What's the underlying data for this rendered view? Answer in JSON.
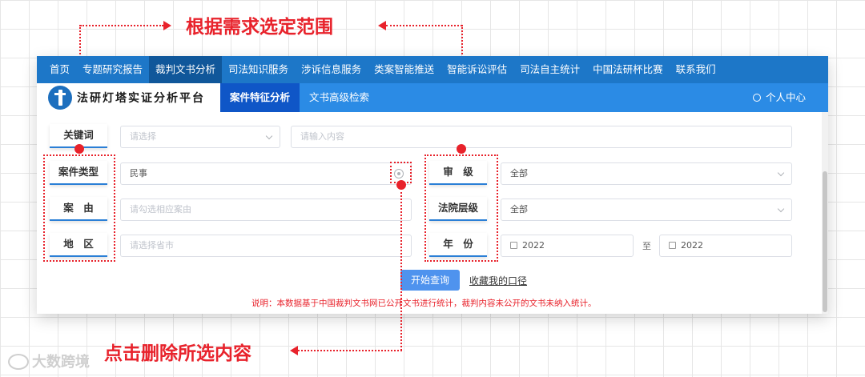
{
  "annotations": {
    "select_range": "根据需求选定范围",
    "click_delete": "点击删除所选内容"
  },
  "top_nav": [
    {
      "label": "首页",
      "active": false
    },
    {
      "label": "专题研究报告",
      "active": false
    },
    {
      "label": "裁判文书分析",
      "active": true
    },
    {
      "label": "司法知识服务",
      "active": false
    },
    {
      "label": "涉诉信息服务",
      "active": false
    },
    {
      "label": "类案智能推送",
      "active": false
    },
    {
      "label": "智能诉讼评估",
      "active": false
    },
    {
      "label": "司法自主统计",
      "active": false
    },
    {
      "label": "中国法研杯比赛",
      "active": false
    },
    {
      "label": "联系我们",
      "active": false
    }
  ],
  "brand": {
    "title": "法研灯塔实证分析平台"
  },
  "sub_tabs": [
    {
      "label": "案件特征分析",
      "active": true
    },
    {
      "label": "文书高级检索",
      "active": false
    }
  ],
  "user_center": "个人中心",
  "form": {
    "keyword": {
      "label": "关键词",
      "select_placeholder": "请选择",
      "input_placeholder": "请输入内容"
    },
    "case_type": {
      "label": "案件类型",
      "value": "民事"
    },
    "cause": {
      "label": "案　由",
      "placeholder": "请勾选相应案由"
    },
    "region": {
      "label": "地　区",
      "placeholder": "请选择省市"
    },
    "trial_level": {
      "label": "审　级",
      "value": "全部"
    },
    "court_level": {
      "label": "法院层级",
      "value": "全部"
    },
    "year": {
      "label": "年　份",
      "from": "2022",
      "sep": "至",
      "to": "2022"
    }
  },
  "actions": {
    "query": "开始查询",
    "save": "收藏我的口径"
  },
  "note": "说明：本数据基于中国裁判文书网已公开文书进行统计，裁判内容未公开的文书未纳入统计。",
  "watermark": "大数跨境",
  "colors": {
    "accent": "#1d77c8",
    "annotation": "#e8222b",
    "button": "#4f93ee"
  }
}
